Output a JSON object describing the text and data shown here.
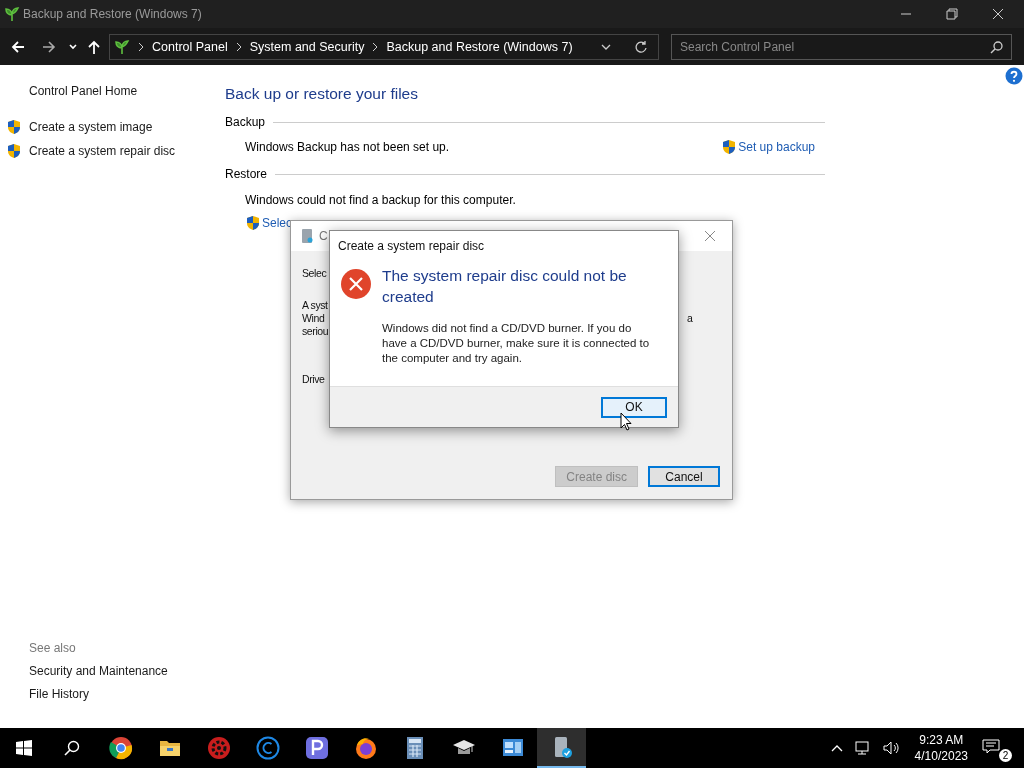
{
  "window": {
    "title": "Backup and Restore (Windows 7)"
  },
  "nav": {
    "breadcrumbs": [
      "Control Panel",
      "System and Security",
      "Backup and Restore (Windows 7)"
    ],
    "search": {
      "placeholder": "Search Control Panel"
    }
  },
  "sidebar": {
    "items": [
      {
        "label": "Control Panel Home",
        "shield": false
      },
      {
        "label": "Create a system image",
        "shield": true
      },
      {
        "label": "Create a system repair disc",
        "shield": true
      }
    ],
    "see_also": {
      "heading": "See also",
      "links": [
        "Security and Maintenance",
        "File History"
      ]
    }
  },
  "main": {
    "heading": "Back up or restore your files",
    "sections": [
      {
        "heading": "Backup",
        "text": "Windows Backup has not been set up.",
        "action": "Set up backup"
      },
      {
        "heading": "Restore",
        "text": "Windows could not find a backup for this computer.",
        "action": "Selec"
      }
    ]
  },
  "back_dialog": {
    "title": "C",
    "left_texts": [
      "Selec",
      "A syst",
      "Wind",
      "seriou",
      "Drive"
    ],
    "right_texts": [
      "a"
    ],
    "buttons": [
      {
        "label": "Create disc",
        "disabled": true,
        "default": false
      },
      {
        "label": "Cancel",
        "disabled": false,
        "default": true
      }
    ]
  },
  "error_dialog": {
    "title": "Create a system repair disc",
    "heading": "The system repair disc could not be created",
    "message": "Windows did not find a CD/DVD burner. If you do have a CD/DVD burner, make sure it is connected to the computer and try again.",
    "button": {
      "label": "OK",
      "focused": true
    }
  },
  "taskbar": {
    "apps": [
      {
        "kind": "chrome",
        "active": false
      },
      {
        "kind": "folder",
        "active": false
      },
      {
        "kind": "gear",
        "active": false
      },
      {
        "kind": "c",
        "active": false
      },
      {
        "kind": "p",
        "active": false
      },
      {
        "kind": "firefox",
        "active": false
      },
      {
        "kind": "calculator",
        "active": false
      },
      {
        "kind": "cap",
        "active": false
      },
      {
        "kind": "panel",
        "active": false
      },
      {
        "kind": "backup",
        "active": true
      }
    ],
    "clock": {
      "time": "9:23 AM",
      "date": "4/10/2023"
    },
    "notifications": "2"
  }
}
